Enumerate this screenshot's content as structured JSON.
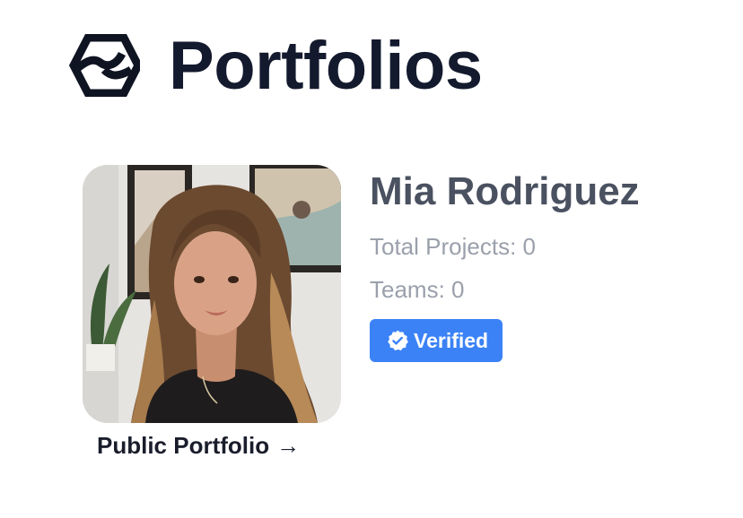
{
  "header": {
    "logo_icon": "hexagon-logo-icon",
    "title": "Portfolios"
  },
  "profile": {
    "name": "Mia Rodriguez",
    "total_projects": "Total Projects: 0",
    "teams": "Teams: 0",
    "badge": {
      "label": "Verified",
      "icon": "verified-check-icon",
      "color": "#3b82f6"
    },
    "avatar_alt": "avatar",
    "public_portfolio_link": "Public Portfolio",
    "link_icon": "arrow-right-icon"
  },
  "colors": {
    "title": "#141a2e",
    "name": "#4a5160",
    "muted": "#9aa0ab",
    "accent": "#3b82f6"
  }
}
